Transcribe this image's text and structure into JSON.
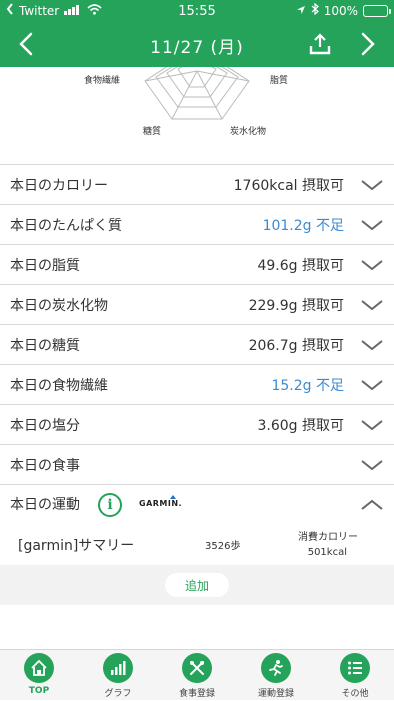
{
  "status": {
    "carrier": "Twitter",
    "time": "15:55",
    "battery": "100%"
  },
  "nav": {
    "title": "11/27 (月)"
  },
  "radar": {
    "labels": [
      "食物繊維",
      "脂質",
      "糖質",
      "炭水化物"
    ]
  },
  "rows": [
    {
      "label": "本日のカロリー",
      "value": "1760kcal 摂取可",
      "status": "ok"
    },
    {
      "label": "本日のたんぱく質",
      "value": "101.2g 不足",
      "status": "warn"
    },
    {
      "label": "本日の脂質",
      "value": "49.6g 摂取可",
      "status": "ok"
    },
    {
      "label": "本日の炭水化物",
      "value": "229.9g 摂取可",
      "status": "ok"
    },
    {
      "label": "本日の糖質",
      "value": "206.7g 摂取可",
      "status": "ok"
    },
    {
      "label": "本日の食物繊維",
      "value": "15.2g 不足",
      "status": "warn"
    },
    {
      "label": "本日の塩分",
      "value": "3.60g 摂取可",
      "status": "ok"
    },
    {
      "label": "本日の食事",
      "value": "",
      "status": "ok"
    }
  ],
  "exercise": {
    "label": "本日の運動",
    "info_icon": "i",
    "brand": "GARMIN.",
    "summary_name": "[garmin]サマリー",
    "steps": "3526歩",
    "calorie_label": "消費カロリー",
    "calorie_value": "501kcal",
    "add_label": "追加"
  },
  "tabs": [
    {
      "label": "TOP",
      "icon": "home-icon",
      "active": true
    },
    {
      "label": "グラフ",
      "icon": "bar-chart-icon",
      "active": false
    },
    {
      "label": "食事登録",
      "icon": "fork-knife-icon",
      "active": false
    },
    {
      "label": "運動登録",
      "icon": "runner-icon",
      "active": false
    },
    {
      "label": "その他",
      "icon": "list-icon",
      "active": false
    }
  ],
  "colors": {
    "brand": "#25a35a",
    "warn": "#3c8bd0"
  }
}
